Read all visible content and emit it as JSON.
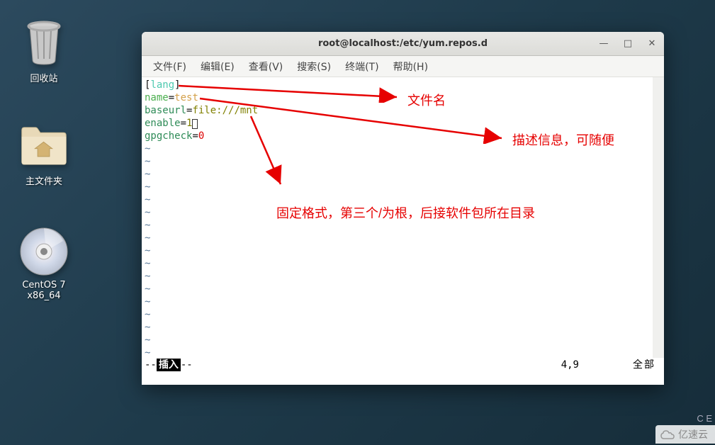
{
  "desktop": {
    "trash": "回收站",
    "home": "主文件夹",
    "cd": "CentOS 7 x86_64"
  },
  "terminal": {
    "title": "root@localhost:/etc/yum.repos.d",
    "menu": {
      "file": "文件(F)",
      "edit": "编辑(E)",
      "view": "查看(V)",
      "search": "搜索(S)",
      "terminal": "终端(T)",
      "help": "帮助(H)"
    },
    "content": {
      "line1_open": "[",
      "line1_lang": "lang",
      "line1_close": "]",
      "line2_key": "name",
      "line2_eq": "=",
      "line2_val": "test",
      "line3_key": "baseurl",
      "line3_eq": "=",
      "line3_val": "file:///mnt",
      "line4_key": "enable",
      "line4_eq": "=",
      "line4_val": "1",
      "line5_key": "gpgcheck",
      "line5_eq": "=",
      "line5_val": "0"
    },
    "status": {
      "mode_prefix": "-- ",
      "mode": "插入",
      "mode_suffix": " --",
      "position": "4,9",
      "scope": "全部"
    }
  },
  "annotations": {
    "a1": "文件名",
    "a2": "描述信息，可随便",
    "a3": "固定格式，第三个/为根，后接软件包所在目录"
  },
  "indicator": "C  E",
  "watermark": "亿速云"
}
